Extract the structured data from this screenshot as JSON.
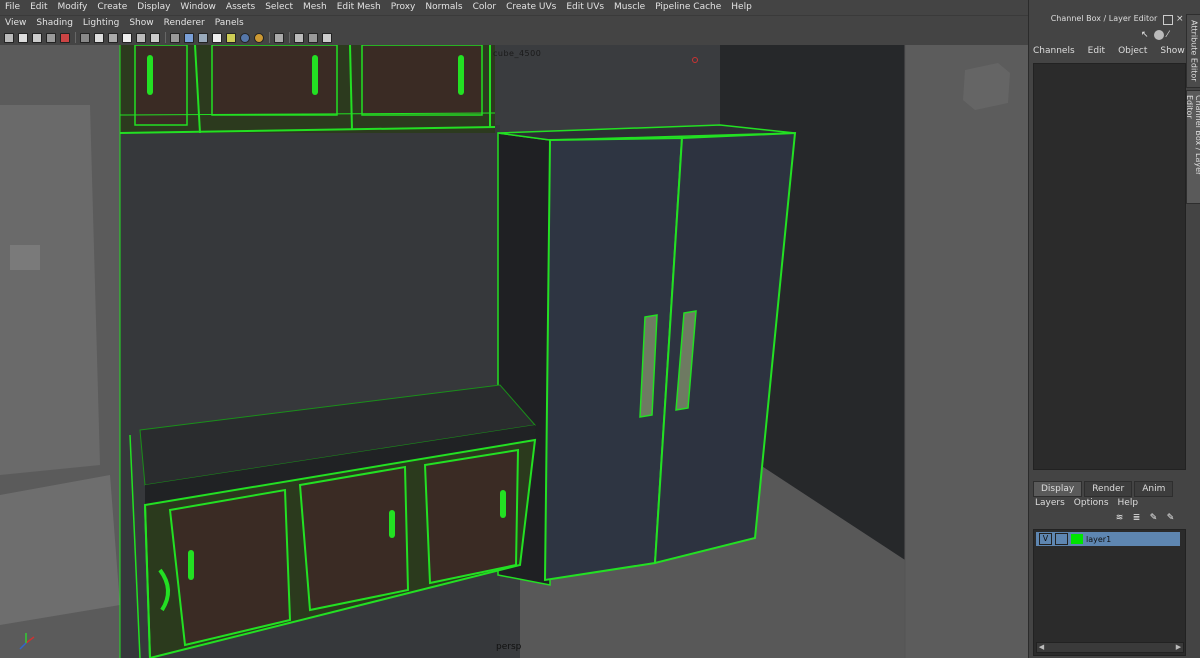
{
  "menubar": [
    "File",
    "Edit",
    "Modify",
    "Create",
    "Display",
    "Window",
    "Assets",
    "Select",
    "Mesh",
    "Edit Mesh",
    "Proxy",
    "Normals",
    "Color",
    "Create UVs",
    "Edit UVs",
    "Muscle",
    "Pipeline Cache",
    "Help"
  ],
  "panel_menu": [
    "View",
    "Shading",
    "Lighting",
    "Show",
    "Renderer",
    "Panels"
  ],
  "toolbar_icons": [
    "camera-icon",
    "bookmark-icon",
    "image-plane-icon",
    "grid-icon",
    "pivot-icon",
    "wireframe-icon",
    "smooth-shade-icon",
    "flat-icon",
    "bounding-box-icon",
    "texture-icon",
    "light-icon",
    "shadow-icon",
    "xray-icon",
    "isolate-icon",
    "cube-icon",
    "cube-small-icon",
    "share-icon"
  ],
  "viewport": {
    "camera_label": "persp",
    "top_readout": "cube_4500"
  },
  "right_panel": {
    "title": "Channel Box / Layer Editor",
    "cb_menu": [
      "Channels",
      "Edit",
      "Object",
      "Show"
    ],
    "side_tabs": [
      "Attribute Editor",
      "Channel Box / Layer Editor"
    ],
    "layer_tabs": [
      "Display",
      "Render",
      "Anim"
    ],
    "layer_menu": [
      "Layers",
      "Options",
      "Help"
    ],
    "layer": {
      "visible": "V",
      "name": "layer1",
      "color": "#00e400"
    }
  },
  "colors": {
    "wire": "#23e023",
    "selection": "#5e86b1"
  }
}
